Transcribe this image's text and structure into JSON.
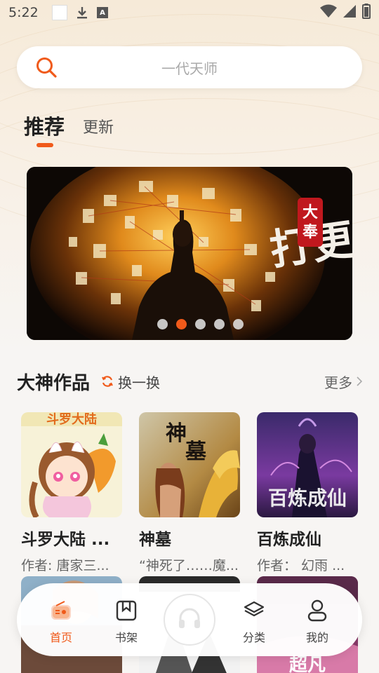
{
  "status_bar": {
    "time": "5:22"
  },
  "search": {
    "placeholder": "一代天师"
  },
  "tabs": [
    {
      "label": "推荐",
      "active": true
    },
    {
      "label": "更新",
      "active": false
    }
  ],
  "banner": {
    "calligraphy": "打更人",
    "seal_text": "大奉",
    "dots_count": 5,
    "active_dot": 1
  },
  "section": {
    "title": "大神作品",
    "refresh_label": "换一换",
    "more_label": "更多"
  },
  "books": [
    {
      "title": "斗罗大陆 ...",
      "desc": "作者: 唐家三..."
    },
    {
      "title": "神墓",
      "desc": "“神死了……魔..."
    },
    {
      "title": "百炼成仙",
      "desc": "作者：  幻雨 ..."
    }
  ],
  "bottom_nav": [
    {
      "label": "首页",
      "icon": "radio-icon",
      "active": true
    },
    {
      "label": "书架",
      "icon": "bookmark-icon",
      "active": false
    },
    {
      "label": "",
      "icon": "headphones-icon",
      "active": false
    },
    {
      "label": "分类",
      "icon": "layers-icon",
      "active": false
    },
    {
      "label": "我的",
      "icon": "user-icon",
      "active": false
    }
  ],
  "colors": {
    "accent": "#f05a1a",
    "background": "#f7f5f3"
  }
}
